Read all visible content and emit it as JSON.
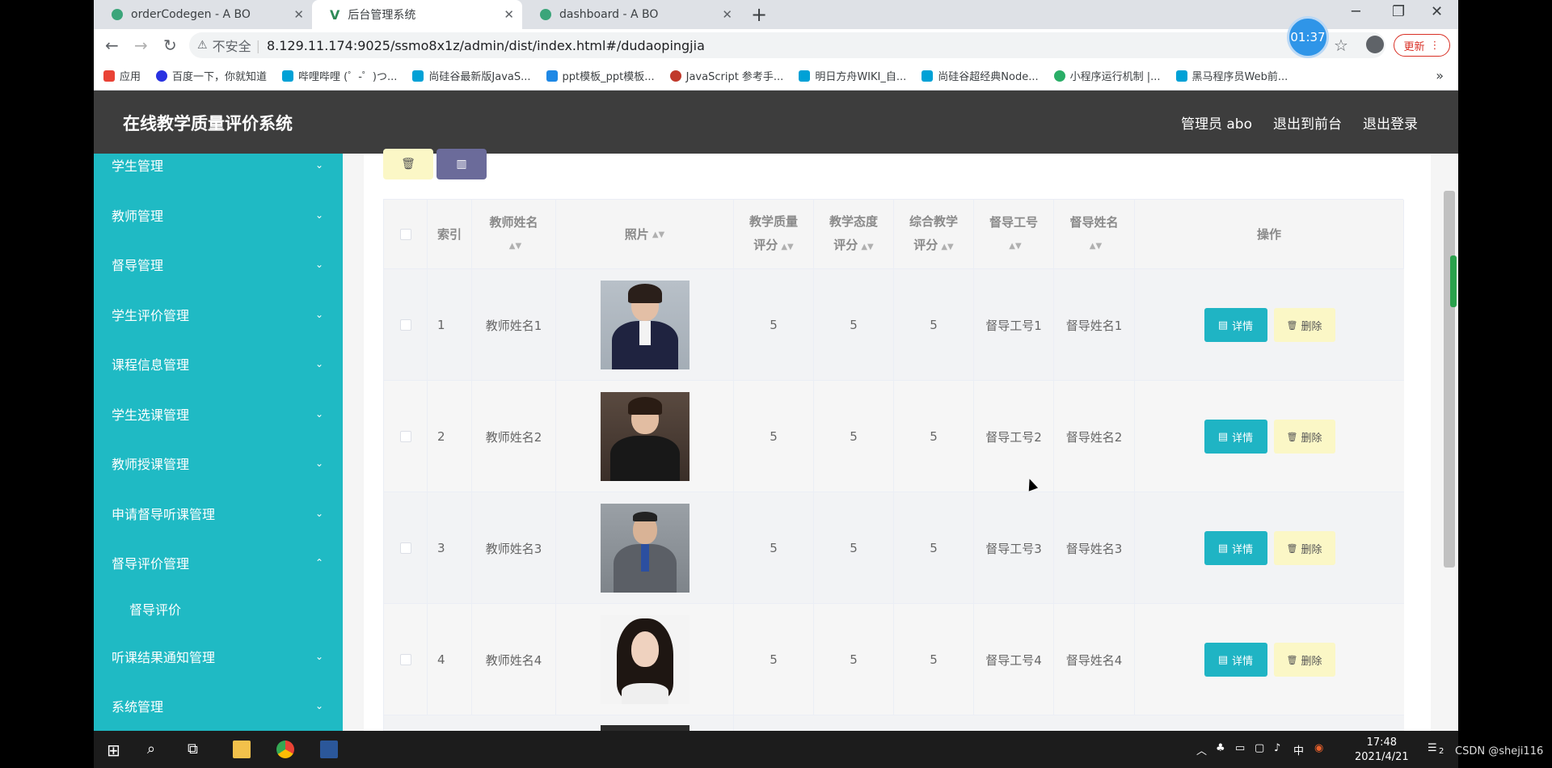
{
  "tabs": [
    {
      "title": "orderCodegen - A BO",
      "close": "✕"
    },
    {
      "title": "后台管理系统",
      "close": "✕"
    },
    {
      "title": "dashboard - A BO",
      "close": "✕"
    }
  ],
  "new_tab": "+",
  "address": {
    "warning": "⚠",
    "insecure": "不安全",
    "url": "8.129.11.174:9025/ssmo8x1z/admin/dist/index.html#/dudaopingjia"
  },
  "timer": "01:37",
  "update_label": "更新",
  "bookmarks": [
    "应用",
    "百度一下，你就知道",
    "哔哩哔哩 (゜-゜)つ...",
    "尚硅谷最新版JavaS...",
    "ppt模板_ppt模板...",
    "JavaScript 参考手...",
    "明日方舟WIKI_自...",
    "尚硅谷超经典Node...",
    "小程序运行机制 |...",
    "黑马程序员Web前..."
  ],
  "bookmarks_more": "»",
  "header": {
    "brand": "在线教学质量评价系统",
    "admin": "管理员 abo",
    "to_front": "退出到前台",
    "logout": "退出登录"
  },
  "sidebar": {
    "items": [
      {
        "label": "学生管理",
        "chev": "⌄"
      },
      {
        "label": "教师管理",
        "chev": "⌄"
      },
      {
        "label": "督导管理",
        "chev": "⌄"
      },
      {
        "label": "学生评价管理",
        "chev": "⌄"
      },
      {
        "label": "课程信息管理",
        "chev": "⌄"
      },
      {
        "label": "学生选课管理",
        "chev": "⌄"
      },
      {
        "label": "教师授课管理",
        "chev": "⌄"
      },
      {
        "label": "申请督导听课管理",
        "chev": "⌄"
      },
      {
        "label": "督导评价管理",
        "chev": "⌃"
      },
      {
        "label": "督导评价",
        "chev": ""
      },
      {
        "label": "听课结果通知管理",
        "chev": "⌄"
      },
      {
        "label": "系统管理",
        "chev": "⌄"
      }
    ]
  },
  "toolbar_icons": {
    "delete": "🗑",
    "chart": "▥"
  },
  "table": {
    "headers": {
      "index": "索引",
      "teacher_name": "教师姓名",
      "photo": "照片",
      "quality_1": "教学质量",
      "quality_2": "评分",
      "attitude_1": "教学态度",
      "attitude_2": "评分",
      "overall_1": "综合教学",
      "overall_2": "评分",
      "supervisor_id": "督导工号",
      "supervisor_name": "督导姓名",
      "actions": "操作"
    },
    "rows": [
      {
        "index": "1",
        "teacher_name": "教师姓名1",
        "quality": "5",
        "attitude": "5",
        "overall": "5",
        "supervisor_id": "督导工号1",
        "supervisor_name": "督导姓名1"
      },
      {
        "index": "2",
        "teacher_name": "教师姓名2",
        "quality": "5",
        "attitude": "5",
        "overall": "5",
        "supervisor_id": "督导工号2",
        "supervisor_name": "督导姓名2"
      },
      {
        "index": "3",
        "teacher_name": "教师姓名3",
        "quality": "5",
        "attitude": "5",
        "overall": "5",
        "supervisor_id": "督导工号3",
        "supervisor_name": "督导姓名3"
      },
      {
        "index": "4",
        "teacher_name": "教师姓名4",
        "quality": "5",
        "attitude": "5",
        "overall": "5",
        "supervisor_id": "督导工号4",
        "supervisor_name": "督导姓名4"
      }
    ],
    "detail_label": "详情",
    "delete_label": "删除",
    "detail_icon": "▤",
    "delete_icon": "🗑"
  },
  "taskbar": {
    "time": "17:48",
    "date": "2021/4/21",
    "ime": "中",
    "notif_count": "2"
  },
  "watermark": "CSDN @sheji116",
  "colors": {
    "sidebar": "#1fbac4",
    "header": "#3d3d3d",
    "detail_button": "#1fb4c4",
    "delete_button": "#fbf7c6"
  }
}
